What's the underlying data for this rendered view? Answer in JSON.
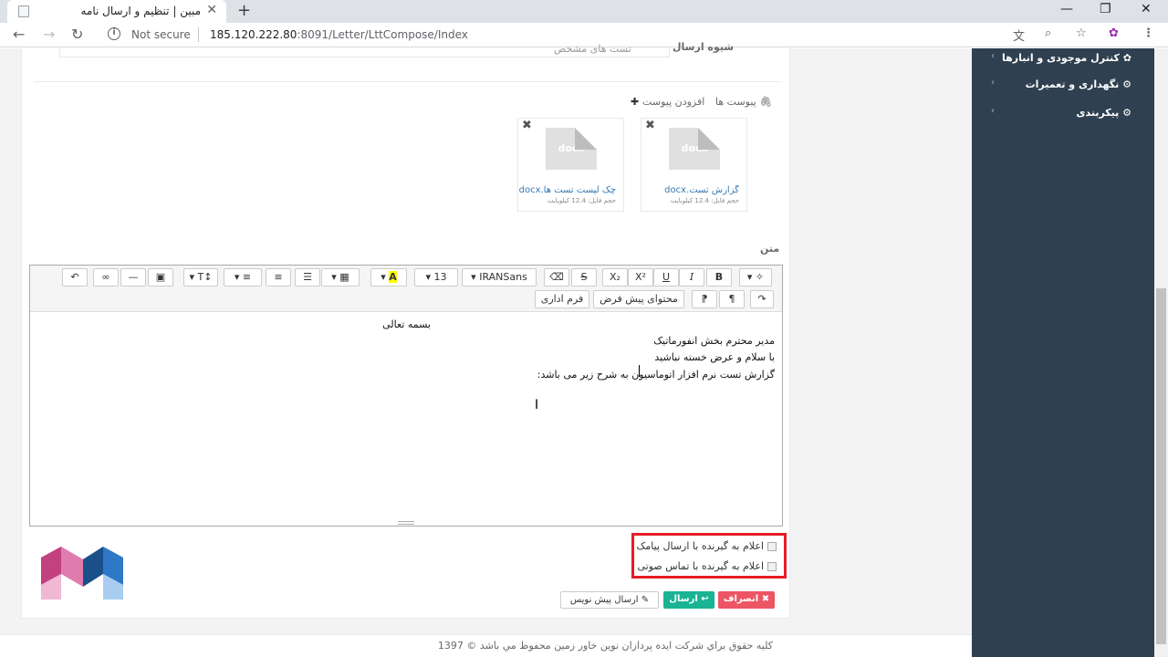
{
  "browser": {
    "tab_title": "مبین | تنظیم و ارسال نامه",
    "tab_close": "✕",
    "new_tab": "+",
    "security": "Not secure",
    "url_host": "185.120.222.80",
    "url_port": ":8091",
    "url_path": "/Letter/LttCompose/Index",
    "win_min": "—",
    "win_max": "❐",
    "win_close": "✕"
  },
  "sidebar": {
    "items": [
      {
        "label": "✿ کنترل موجودی و انبارها"
      },
      {
        "label": "⚙ نگهداری و تعمیرات"
      },
      {
        "label": "⚙ پیکربندی"
      }
    ],
    "chevron": "‹"
  },
  "form": {
    "top_label": "شیوه ارسال",
    "top_field_value": "تست های مشخص",
    "attachments_label": "پیوست ها",
    "add_attachment": "افزودن پیوست",
    "attachments": [
      {
        "ext": "docx",
        "name": "گزارش تست.docx",
        "size": "حجم فایل: 12.4 کیلوبایت"
      },
      {
        "ext": "docx",
        "name": "چک لیست تست ها.docx",
        "size": "حجم فایل: 12.4 کیلوبایت"
      }
    ],
    "body_label": "متن"
  },
  "editor": {
    "font_name": "IRANSans",
    "font_size": "13",
    "tpl_default": "محتوای پیش فرض",
    "tpl_admin": "فرم اداری",
    "lines": [
      "بسمه تعالی",
      "مدیر محترم بخش انفورماتیک",
      "با سلام و عرض خسته نباشید",
      "گزارش تست نرم افزار اتوماسیون به شرح زیر می باشد:"
    ]
  },
  "options": {
    "sms": "اعلام به گیرنده با ارسال پیامک",
    "voice": "اعلام به گیرنده با تماس صوتی"
  },
  "buttons": {
    "cancel": "✖ انصراف",
    "send": "↩ ارسال",
    "draft": "✎ ارسال پیش نویس"
  },
  "footer": {
    "text": "کلیه حقوق براي شرکت ایده پردازان نوین خاور زمین محفوظ مي باشد © 1397"
  },
  "colors": {
    "sidebar": "#2f4050",
    "primary": "#1ab394",
    "danger": "#ed5565",
    "highlight_border": "#e41e26"
  }
}
